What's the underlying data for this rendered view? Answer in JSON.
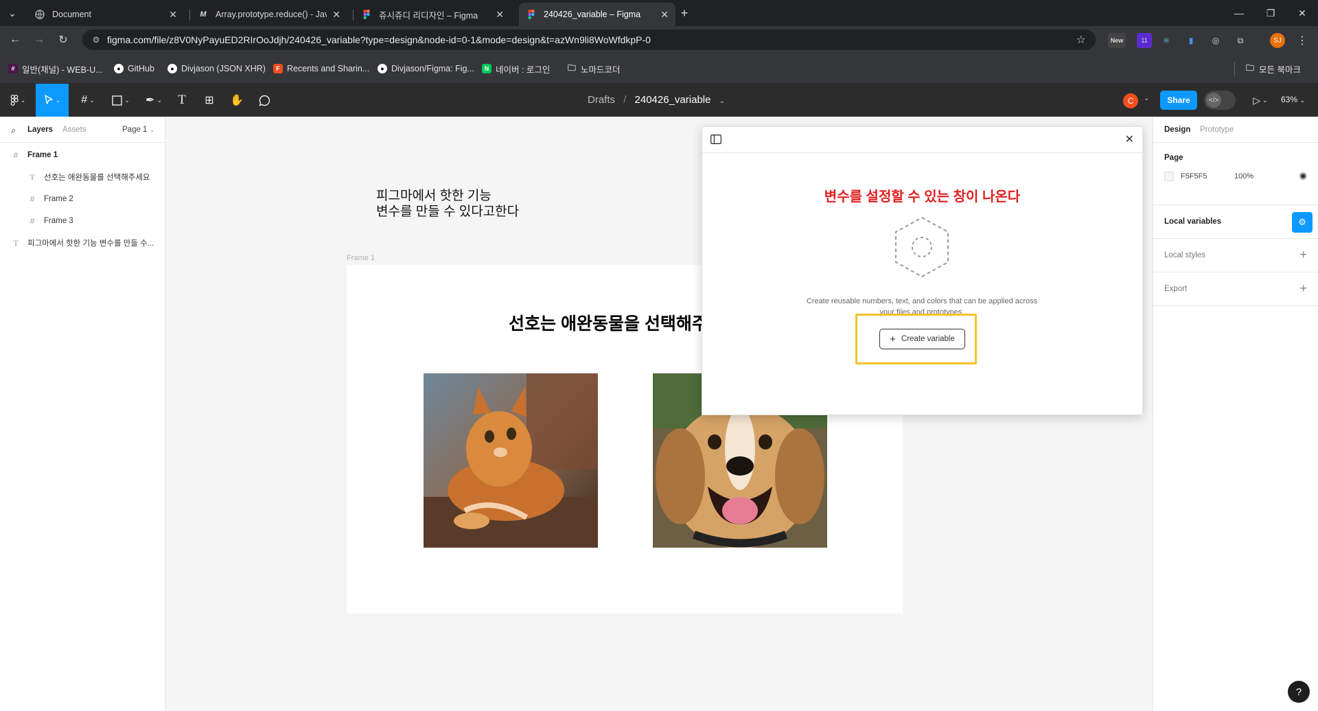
{
  "browser": {
    "tabs": [
      {
        "title": "Document"
      },
      {
        "title": "Array.prototype.reduce() - JavaScript"
      },
      {
        "title": "쥬시쥬디 리디자인 – Figma"
      },
      {
        "title": "240426_variable – Figma"
      }
    ],
    "url": "figma.com/file/z8V0NyPayuED2RIrOoJdjh/240426_variable?type=design&node-id=0-1&mode=design&t=azWn9li8WoWfdkpP-0",
    "extensions": {
      "new_label": "New",
      "badge_count": "11",
      "profile_initials": "SJ"
    },
    "bookmarks": [
      {
        "label": "일반(채널) - WEB-U..."
      },
      {
        "label": "GitHub"
      },
      {
        "label": "Divjason (JSON XHR)"
      },
      {
        "label": "Recents and Sharin..."
      },
      {
        "label": "Divjason/Figma: Fig..."
      },
      {
        "label": "네이버 : 로그인"
      },
      {
        "label": "노마드코더"
      }
    ],
    "all_bookmarks": "모든 북마크"
  },
  "figma": {
    "breadcrumb": {
      "folder": "Drafts",
      "separator": "/",
      "file": "240426_variable"
    },
    "user_initial": "C",
    "share_label": "Share",
    "zoom": "63%"
  },
  "layers_panel": {
    "tabs": {
      "layers": "Layers",
      "assets": "Assets",
      "page": "Page 1"
    },
    "items": [
      {
        "label": "Frame 1",
        "icon": "frame-icon"
      },
      {
        "label": "선호는 애완동물를 선택해주세요",
        "icon": "text-icon"
      },
      {
        "label": "Frame 2",
        "icon": "frame-icon"
      },
      {
        "label": "Frame 3",
        "icon": "frame-icon"
      },
      {
        "label": "피그마에서 핫한 기능 변수를 만들 수...",
        "icon": "text-icon"
      }
    ]
  },
  "canvas": {
    "text_line1": "피그마에서 핫한 기능",
    "text_line2": "변수를 만들 수 있다고한다",
    "frame_label": "Frame 1",
    "frame_heading": "선호는 애완동물을 선택해주세요"
  },
  "variables_modal": {
    "annotation": "변수를 설정할 수 있는 창이 나온다",
    "description": "Create reusable numbers, text, and colors that can be applied across your files and prototypes.",
    "create_button": "Create variable"
  },
  "right_panel": {
    "tabs": {
      "design": "Design",
      "prototype": "Prototype"
    },
    "page_label": "Page",
    "page_color": "F5F5F5",
    "page_opacity": "100%",
    "local_variables": "Local variables",
    "local_styles": "Local styles",
    "export": "Export"
  },
  "colors": {
    "accent": "#0d99ff",
    "annotation_red": "#e02020",
    "highlight": "#f5c227"
  }
}
